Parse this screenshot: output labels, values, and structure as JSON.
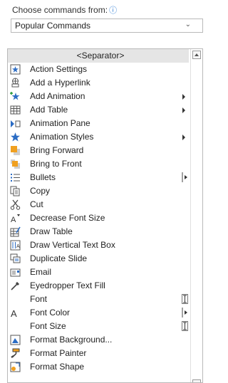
{
  "chooser": {
    "label": "Choose commands from:",
    "info_icon": "info-icon",
    "selected": "Popular Commands"
  },
  "commands": [
    {
      "label": "<Separator>",
      "icon": "none",
      "selected": true
    },
    {
      "label": "Action Settings",
      "icon": "action-settings-icon"
    },
    {
      "label": "Add a Hyperlink",
      "icon": "hyperlink-icon"
    },
    {
      "label": "Add Animation",
      "icon": "add-animation-icon",
      "submenu": true
    },
    {
      "label": "Add Table",
      "icon": "table-icon",
      "submenu": true
    },
    {
      "label": "Animation Pane",
      "icon": "animation-pane-icon"
    },
    {
      "label": "Animation Styles",
      "icon": "animation-styles-icon",
      "submenu": true
    },
    {
      "label": "Bring Forward",
      "icon": "bring-forward-icon"
    },
    {
      "label": "Bring to Front",
      "icon": "bring-to-front-icon"
    },
    {
      "label": "Bullets",
      "icon": "bullets-icon",
      "picker": "bar"
    },
    {
      "label": "Copy",
      "icon": "copy-icon"
    },
    {
      "label": "Cut",
      "icon": "cut-icon"
    },
    {
      "label": "Decrease Font Size",
      "icon": "decrease-font-size-icon"
    },
    {
      "label": "Draw Table",
      "icon": "draw-table-icon"
    },
    {
      "label": "Draw Vertical Text Box",
      "icon": "vertical-text-box-icon"
    },
    {
      "label": "Duplicate Slide",
      "icon": "duplicate-slide-icon"
    },
    {
      "label": "Email",
      "icon": "email-icon"
    },
    {
      "label": "Eyedropper Text Fill",
      "icon": "eyedropper-icon"
    },
    {
      "label": "Font",
      "icon": "none",
      "picker": "ibar"
    },
    {
      "label": "Font Color",
      "icon": "font-color-icon",
      "picker": "bar"
    },
    {
      "label": "Font Size",
      "icon": "none",
      "picker": "ibar"
    },
    {
      "label": "Format Background...",
      "icon": "format-background-icon"
    },
    {
      "label": "Format Painter",
      "icon": "format-painter-icon"
    },
    {
      "label": "Format Shape",
      "icon": "format-shape-icon"
    }
  ],
  "colors": {
    "accent": "#2a7ad5",
    "icon_blue": "#2b6cc4",
    "icon_orange": "#f0a020",
    "selected_bg": "#e5e5e5",
    "border": "#b9b9b9"
  }
}
